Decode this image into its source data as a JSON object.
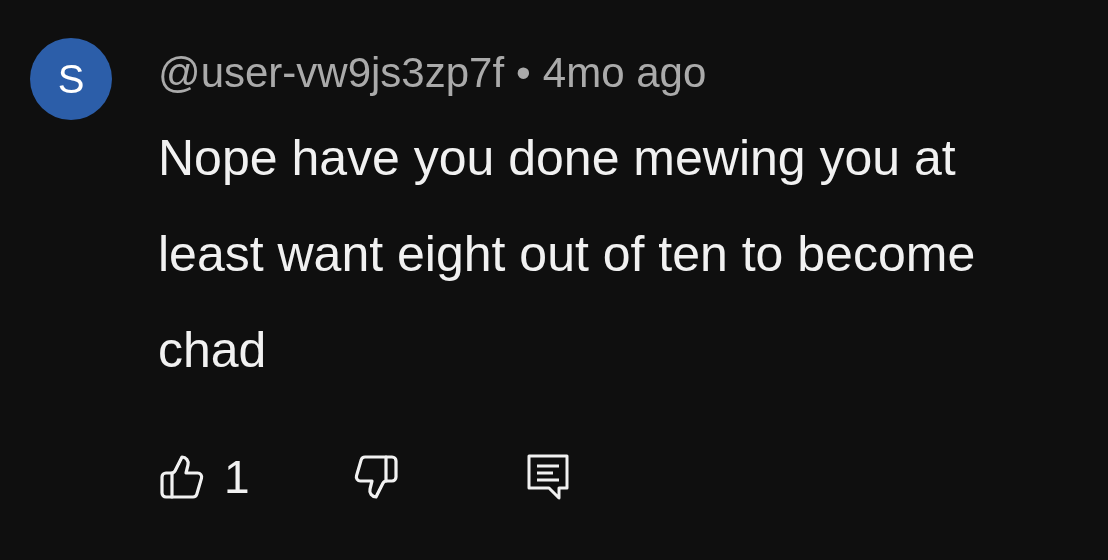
{
  "comment": {
    "avatar_letter": "S",
    "author": "@user-vw9js3zp7f",
    "separator": "•",
    "time": "4mo ago",
    "text": "Nope have you done mewing you at least want eight out of ten to become chad",
    "likes": "1"
  }
}
